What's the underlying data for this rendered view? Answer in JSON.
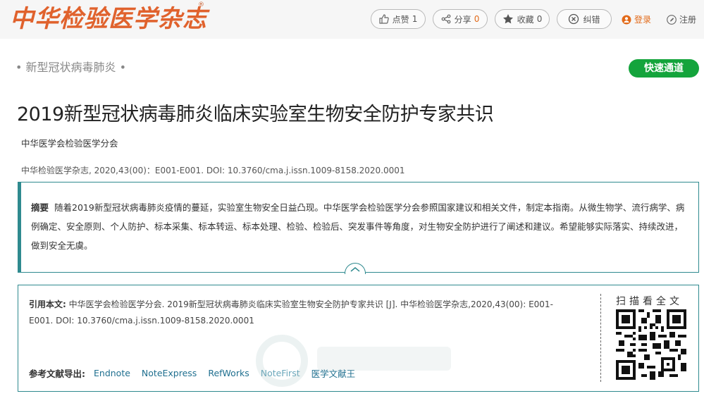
{
  "header": {
    "logo_text": "中华检验医学杂志",
    "logo_mark": "®",
    "like_label": "点赞",
    "like_count": "1",
    "share_label": "分享",
    "share_count": "0",
    "collect_label": "收藏",
    "collect_count": "0",
    "correct_label": "纠错",
    "login_label": "登录",
    "register_label": "注册"
  },
  "category": {
    "label": "新型冠状病毒肺炎",
    "bullet": "•"
  },
  "quick_access_label": "快速通道",
  "article": {
    "title": "2019新型冠状病毒肺炎临床实验室生物安全防护专家共识",
    "author": "中华医学会检验医学分会",
    "citation_line": "中华检验医学杂志, 2020,43(00)：E001-E001. DOI: 10.3760/cma.j.issn.1009-8158.2020.0001"
  },
  "abstract": {
    "label": "摘要",
    "text": "随着2019新型冠状病毒肺炎疫情的蔓延，实验室生物安全日益凸现。中华医学会检验医学分会参照国家建议和相关文件，制定本指南。从微生物学、流行病学、病例确定、安全原则、个人防护、标本采集、标本转运、标本处理、检验、检验后、突发事件等角度，对生物安全防护进行了阐述和建议。希望能够实际落实、持续改进，做到安全无虞。"
  },
  "citation": {
    "label": "引用本文:",
    "text": "中华医学会检验医学分会. 2019新型冠状病毒肺炎临床实验室生物安全防护专家共识 [J]. 中华检验医学杂志,2020,43(00): E001-E001. DOI: 10.3760/cma.j.issn.1009-8158.2020.0001",
    "export_label": "参考文献导出:",
    "export_links": [
      "Endnote",
      "NoteExpress",
      "RefWorks",
      "NoteFirst",
      "医学文献王"
    ],
    "scan_label": "扫描看全文"
  },
  "colors": {
    "brand_orange": "#e0622d",
    "teal_border": "#2f8a8f",
    "green_button": "#14a43c",
    "link_blue": "#1f6f8f"
  }
}
